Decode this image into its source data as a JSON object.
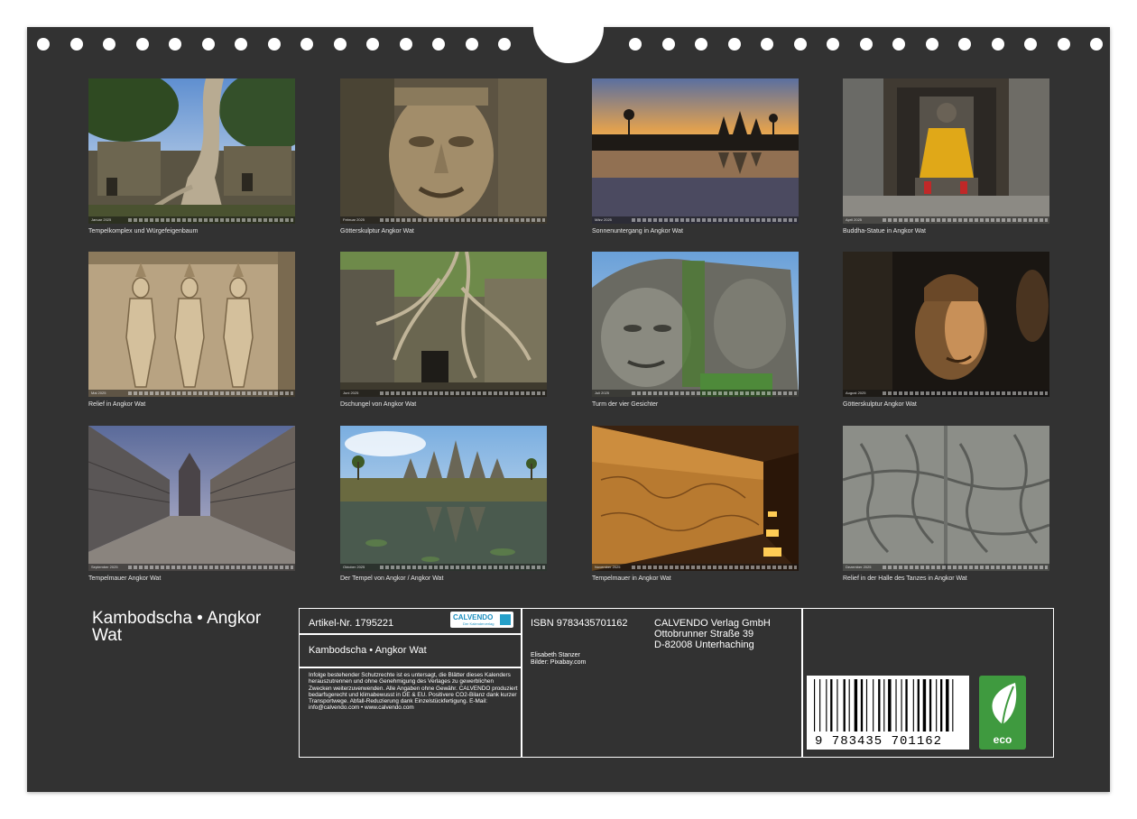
{
  "tiles": [
    {
      "month": "Januar 2025",
      "caption": "Tempelkomplex und Würgefeigenbaum",
      "scene": "jungle-temple"
    },
    {
      "month": "Februar 2025",
      "caption": "Götterskulptur Angkor Wat",
      "scene": "stone-face"
    },
    {
      "month": "März 2025",
      "caption": "Sonnenuntergang in Angkor Wat",
      "scene": "sunset"
    },
    {
      "month": "April 2025",
      "caption": "Buddha-Statue in Angkor Wat",
      "scene": "buddha"
    },
    {
      "month": "Mai 2025",
      "caption": "Relief in Angkor Wat",
      "scene": "relief-apsaras"
    },
    {
      "month": "Juni 2025",
      "caption": "Dschungel von Angkor Wat",
      "scene": "roots"
    },
    {
      "month": "Juli 2025",
      "caption": "Turm der vier Gesichter",
      "scene": "face-tower"
    },
    {
      "month": "August 2025",
      "caption": "Götterskulptur Angkor Wat",
      "scene": "dark-sculpture"
    },
    {
      "month": "September 2025",
      "caption": "Tempelmauer Angkor Wat",
      "scene": "wall-path"
    },
    {
      "month": "Oktober 2025",
      "caption": "Der Tempel von Angkor / Angkor Wat",
      "scene": "angkor-reflection"
    },
    {
      "month": "November 2025",
      "caption": "Tempelmauer in Angkor Wat",
      "scene": "gallery"
    },
    {
      "month": "Dezember 2025",
      "caption": "Relief in der Halle des Tanzes in Angkor Wat",
      "scene": "grey-relief"
    }
  ],
  "cover_title": "Kambodscha • Angkor Wat",
  "info": {
    "article_label": "Artikel-Nr. 1795221",
    "title": "Kambodscha • Angkor Wat",
    "legal_text": "Infolge bestehender Schutzrechte ist es untersagt, die Blätter dieses Kalenders herauszutrennen und ohne Genehmigung des Verlages zu gewerblichen Zwecken weiterzuverwenden. Alle Angaben ohne Gewähr. CALVENDO produziert bedarfsgerecht und klimabewusst in DE & EU. Positivere CO2-Bilanz dank kurzer Transportwege. Abfall-Reduzierung dank Einzelstückfertigung. E-Mail: info@calvendo.com • www.calvendo.com",
    "isbn": "ISBN 9783435701162",
    "publisher_name": "CALVENDO Verlag GmbH",
    "publisher_street": "Ottobrunner Straße 39",
    "publisher_city": "D-82008 Unterhaching",
    "author": "Elisabeth Stanzer",
    "images_credit": "Bilder: Pixabay.com",
    "barcode_number": "9 783435 701162",
    "eco_label": "eco",
    "logo_name": "CALVENDO",
    "logo_tagline": "Der Kalenderverlag"
  },
  "colors": {
    "background": "#323232",
    "lines": "#ffffff",
    "eco_green": "#3f9a3f",
    "logo_blue": "#1c8fbf"
  }
}
